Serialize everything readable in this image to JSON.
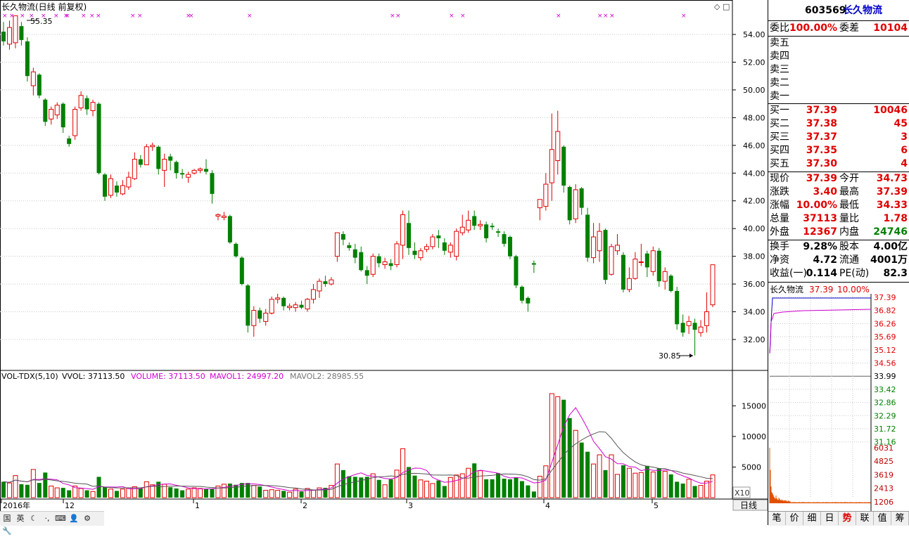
{
  "chart_title": "长久物流(日线 前复权)",
  "high_marker": "55.35",
  "low_marker": "30.85",
  "price_axis": [
    "54.00",
    "52.00",
    "50.00",
    "48.00",
    "46.00",
    "44.00",
    "42.00",
    "40.00",
    "38.00",
    "36.00",
    "34.00",
    "32.00"
  ],
  "date_axis": [
    "2016年",
    "12",
    "1",
    "2",
    "3",
    "4",
    "5"
  ],
  "vol_legend": {
    "name": "VOL-TDX(5,10)",
    "vvol": "VVOL: 37113.50",
    "volume": "VOLUME: 37113.50",
    "mavol1": "MAVOL1: 24997.20",
    "mavol2": "MAVOL2: 28985.55"
  },
  "vol_axis": [
    "15000",
    "10000",
    "5000"
  ],
  "vol_unit": "X10",
  "period_button": "日线",
  "colors": {
    "up": "#e00000",
    "down": "#008000",
    "ma1": "#d000d0",
    "ma2": "#555555",
    "grid": "#c8c8c8"
  },
  "chart_data": {
    "type": "candlestick",
    "y_range": [
      30.0,
      56.0
    ],
    "candles": [
      [
        54.2,
        53.5,
        54.9,
        53.2
      ],
      [
        53.3,
        54.5,
        55.0,
        52.9
      ],
      [
        53.4,
        55.35,
        55.35,
        53.0
      ],
      [
        54.6,
        53.6,
        54.9,
        53.2
      ],
      [
        53.5,
        51.0,
        53.8,
        50.6
      ],
      [
        50.3,
        51.3,
        51.6,
        49.6
      ],
      [
        51.1,
        49.6,
        51.2,
        49.4
      ],
      [
        49.3,
        47.7,
        49.4,
        47.4
      ],
      [
        47.9,
        48.6,
        48.8,
        47.5
      ],
      [
        48.2,
        48.9,
        49.1,
        47.9
      ],
      [
        49.0,
        47.3,
        49.1,
        46.9
      ],
      [
        46.5,
        46.1,
        46.7,
        45.9
      ],
      [
        46.7,
        48.6,
        48.8,
        46.4
      ],
      [
        48.7,
        49.6,
        49.9,
        48.5
      ],
      [
        49.4,
        48.6,
        49.6,
        48.2
      ],
      [
        48.5,
        49.1,
        49.3,
        48.1
      ],
      [
        49.0,
        44.0,
        49.1,
        43.9
      ],
      [
        43.9,
        42.3,
        44.0,
        42.0
      ],
      [
        42.4,
        43.6,
        43.9,
        42.2
      ],
      [
        43.1,
        42.6,
        43.4,
        42.3
      ],
      [
        42.5,
        43.1,
        43.5,
        42.4
      ],
      [
        43.0,
        43.7,
        44.1,
        42.8
      ],
      [
        43.6,
        45.0,
        45.5,
        43.5
      ],
      [
        45.0,
        44.6,
        45.3,
        44.4
      ],
      [
        44.6,
        45.9,
        46.1,
        44.6
      ],
      [
        45.9,
        46.0,
        46.2,
        45.6
      ],
      [
        45.9,
        44.3,
        46.0,
        43.9
      ],
      [
        44.2,
        45.0,
        45.4,
        43.0
      ],
      [
        45.2,
        44.9,
        45.4,
        44.2
      ],
      [
        44.8,
        44.0,
        44.9,
        43.6
      ],
      [
        44.0,
        43.9,
        44.3,
        43.6
      ],
      [
        43.7,
        43.9,
        44.1,
        43.3
      ],
      [
        44.0,
        44.2,
        44.3,
        43.9
      ],
      [
        44.2,
        44.3,
        44.4,
        44.0
      ],
      [
        44.3,
        44.1,
        45.0,
        43.9
      ],
      [
        44.0,
        42.5,
        44.2,
        41.8
      ],
      [
        40.9,
        41.0,
        41.1,
        40.6
      ],
      [
        40.8,
        40.9,
        41.2,
        40.6
      ],
      [
        40.9,
        39.0,
        41.0,
        38.9
      ],
      [
        38.9,
        38.0,
        39.0,
        37.9
      ],
      [
        37.9,
        36.0,
        38.0,
        35.9
      ],
      [
        35.9,
        33.0,
        36.0,
        32.5
      ],
      [
        33.0,
        34.1,
        34.4,
        32.2
      ],
      [
        34.1,
        33.5,
        34.3,
        33.2
      ],
      [
        33.3,
        33.9,
        34.2,
        33.0
      ],
      [
        33.9,
        34.9,
        35.1,
        33.8
      ],
      [
        34.9,
        35.0,
        35.3,
        34.6
      ],
      [
        35.0,
        34.4,
        35.1,
        34.1
      ],
      [
        34.3,
        34.4,
        34.6,
        34.1
      ],
      [
        34.3,
        34.5,
        34.7,
        34.0
      ],
      [
        34.5,
        34.3,
        34.8,
        34.2
      ],
      [
        34.2,
        34.9,
        35.0,
        34.0
      ],
      [
        34.9,
        35.6,
        36.0,
        34.6
      ],
      [
        35.5,
        36.2,
        36.4,
        35.0
      ],
      [
        36.2,
        36.0,
        36.6,
        35.8
      ],
      [
        36.0,
        36.3,
        36.5,
        35.9
      ],
      [
        38.0,
        39.7,
        39.7,
        37.6
      ],
      [
        39.6,
        39.2,
        39.8,
        38.8
      ],
      [
        38.8,
        38.6,
        39.0,
        38.4
      ],
      [
        38.5,
        37.9,
        38.9,
        37.5
      ],
      [
        38.3,
        37.0,
        38.7,
        36.9
      ],
      [
        37.0,
        36.6,
        37.3,
        36.0
      ],
      [
        36.7,
        38.0,
        38.2,
        36.5
      ],
      [
        38.0,
        37.5,
        38.2,
        37.2
      ],
      [
        37.4,
        37.6,
        37.9,
        37.1
      ],
      [
        37.5,
        37.3,
        37.8,
        37.0
      ],
      [
        37.4,
        38.9,
        39.1,
        37.2
      ],
      [
        38.8,
        41.0,
        41.3,
        37.8
      ],
      [
        40.4,
        38.6,
        41.3,
        38.1
      ],
      [
        38.4,
        38.1,
        39.0,
        37.8
      ],
      [
        37.9,
        38.4,
        38.6,
        37.7
      ],
      [
        38.5,
        38.7,
        38.9,
        38.3
      ],
      [
        38.7,
        39.4,
        39.6,
        38.5
      ],
      [
        39.5,
        39.3,
        39.9,
        38.6
      ],
      [
        39.0,
        38.4,
        39.3,
        38.1
      ],
      [
        38.3,
        38.8,
        39.0,
        37.9
      ],
      [
        38.0,
        39.8,
        40.0,
        37.7
      ],
      [
        39.7,
        40.1,
        41.0,
        39.5
      ],
      [
        39.9,
        40.6,
        41.3,
        39.7
      ],
      [
        40.9,
        40.2,
        41.3,
        39.9
      ],
      [
        40.2,
        40.3,
        40.6,
        39.9
      ],
      [
        40.3,
        39.3,
        40.5,
        39.0
      ],
      [
        40.2,
        40.1,
        40.4,
        39.9
      ],
      [
        39.8,
        39.7,
        40.0,
        39.4
      ],
      [
        39.6,
        38.9,
        39.8,
        38.7
      ],
      [
        39.4,
        38.0,
        39.5,
        37.8
      ],
      [
        38.0,
        35.9,
        38.1,
        35.7
      ],
      [
        35.8,
        34.8,
        35.9,
        34.6
      ],
      [
        35.0,
        34.6,
        35.1,
        34.0
      ],
      [
        37.5,
        37.4,
        37.7,
        36.8
      ],
      [
        41.5,
        42.1,
        42.1,
        40.6
      ],
      [
        41.6,
        43.2,
        44.0,
        41.3
      ],
      [
        43.3,
        45.7,
        48.3,
        42.0
      ],
      [
        44.9,
        47.0,
        48.5,
        43.9
      ],
      [
        45.9,
        43.1,
        46.0,
        42.6
      ],
      [
        43.0,
        40.6,
        43.1,
        40.3
      ],
      [
        40.7,
        42.8,
        43.2,
        40.4
      ],
      [
        42.9,
        41.5,
        43.0,
        41.0
      ],
      [
        41.0,
        37.9,
        41.5,
        37.6
      ],
      [
        37.9,
        39.4,
        40.4,
        37.5
      ],
      [
        38.4,
        39.8,
        40.4,
        37.6
      ],
      [
        39.9,
        36.3,
        40.0,
        36.0
      ],
      [
        36.7,
        38.7,
        38.9,
        36.6
      ],
      [
        38.4,
        38.8,
        39.6,
        38.1
      ],
      [
        38.1,
        35.6,
        38.3,
        35.4
      ],
      [
        35.6,
        36.4,
        37.2,
        35.4
      ],
      [
        36.4,
        37.8,
        38.3,
        36.3
      ],
      [
        37.6,
        37.6,
        38.9,
        37.3
      ],
      [
        38.2,
        37.2,
        38.4,
        36.5
      ],
      [
        36.9,
        38.4,
        38.7,
        36.6
      ],
      [
        38.4,
        36.2,
        38.6,
        35.8
      ],
      [
        36.2,
        36.9,
        37.2,
        35.6
      ],
      [
        36.6,
        35.5,
        36.7,
        35.4
      ],
      [
        35.5,
        33.1,
        35.8,
        32.7
      ],
      [
        33.2,
        32.5,
        33.8,
        32.2
      ],
      [
        33.0,
        33.3,
        33.7,
        32.4
      ],
      [
        33.2,
        32.7,
        33.5,
        30.85
      ],
      [
        32.5,
        32.9,
        33.4,
        32.2
      ],
      [
        33.0,
        34.0,
        35.4,
        32.5
      ],
      [
        34.5,
        37.39,
        37.39,
        34.33
      ]
    ],
    "volume": [
      2600,
      2400,
      3600,
      2200,
      2100,
      4600,
      2400,
      4100,
      1900,
      1600,
      1600,
      1200,
      1900,
      1500,
      1200,
      1000,
      3400,
      1700,
      1400,
      1100,
      1400,
      1600,
      1800,
      1500,
      2600,
      2100,
      2600,
      2200,
      1700,
      1500,
      1200,
      1400,
      1600,
      1500,
      1400,
      1400,
      1900,
      2200,
      2300,
      2100,
      2400,
      2400,
      2000,
      1800,
      1200,
      1300,
      1200,
      1100,
      900,
      1400,
      1000,
      1500,
      1200,
      1600,
      1600,
      2000,
      5500,
      4500,
      3500,
      3400,
      3300,
      3400,
      3900,
      2900,
      2100,
      3000,
      4500,
      8000,
      5000,
      3600,
      2900,
      2700,
      2300,
      2800,
      1900,
      3300,
      3700,
      3900,
      4800,
      5600,
      4400,
      3000,
      3000,
      4000,
      3100,
      3000,
      3300,
      2700,
      2000,
      1000,
      3500,
      5200,
      17000,
      16500,
      16000,
      13000,
      11000,
      9000,
      7500,
      5500,
      7000,
      4500,
      7000,
      3800,
      5300,
      4800,
      4000,
      4100,
      5200,
      4200,
      4800,
      4300,
      3800,
      2600,
      2300,
      3000,
      1900,
      2000,
      2700,
      3711
    ],
    "intraday_axis": [
      "37.39",
      "36.82",
      "36.26",
      "35.69",
      "35.12",
      "34.56",
      "33.99",
      "33.42",
      "32.86",
      "32.29",
      "31.72",
      "31.16"
    ],
    "intraday_vol_axis": [
      "6031",
      "4825",
      "3619",
      "2413",
      "1206"
    ]
  },
  "quote": {
    "code": "603569",
    "name": "长久物流",
    "weibi_label": "委比",
    "weibi": "100.00%",
    "weicha_label": "委差",
    "weicha": "10104",
    "asks": [
      "卖五",
      "卖四",
      "卖三",
      "卖二",
      "卖一"
    ],
    "bids": [
      {
        "label": "买一",
        "price": "37.39",
        "vol": "10046"
      },
      {
        "label": "买二",
        "price": "37.38",
        "vol": "45"
      },
      {
        "label": "买三",
        "price": "37.37",
        "vol": "3"
      },
      {
        "label": "买四",
        "price": "37.35",
        "vol": "6"
      },
      {
        "label": "买五",
        "price": "37.30",
        "vol": "4"
      }
    ],
    "stats": [
      {
        "l1": "现价",
        "v1": "37.39",
        "c1": "red",
        "l2": "今开",
        "v2": "34.73",
        "c2": "red"
      },
      {
        "l1": "涨跌",
        "v1": "3.40",
        "c1": "red",
        "l2": "最高",
        "v2": "37.39",
        "c2": "red"
      },
      {
        "l1": "涨幅",
        "v1": "10.00%",
        "c1": "red",
        "l2": "最低",
        "v2": "34.33",
        "c2": "red"
      },
      {
        "l1": "总量",
        "v1": "37113",
        "c1": "red",
        "l2": "量比",
        "v2": "1.78",
        "c2": "red"
      },
      {
        "l1": "外盘",
        "v1": "12367",
        "c1": "red",
        "l2": "内盘",
        "v2": "24746",
        "c2": "green"
      }
    ],
    "stats2": [
      {
        "l1": "换手",
        "v1": "9.28%",
        "l2": "股本",
        "v2": "4.00亿"
      },
      {
        "l1": "净资",
        "v1": "4.72",
        "l2": "流通",
        "v2": "4001万"
      },
      {
        "l1": "收益(一)",
        "v1": "0.114",
        "l2": "PE(动)",
        "v2": "82.3"
      }
    ],
    "mini_title": "长久物流",
    "mini_price": "37.39",
    "mini_pct": "10.00%"
  },
  "bottom_tabs": [
    "笔",
    "价",
    "细",
    "日",
    "势",
    "联",
    "值",
    "筹"
  ],
  "active_tab": "势",
  "toolbar": [
    "国",
    "英",
    "☾",
    "·,",
    "⌨",
    "👤",
    "⚙",
    "🔧"
  ]
}
